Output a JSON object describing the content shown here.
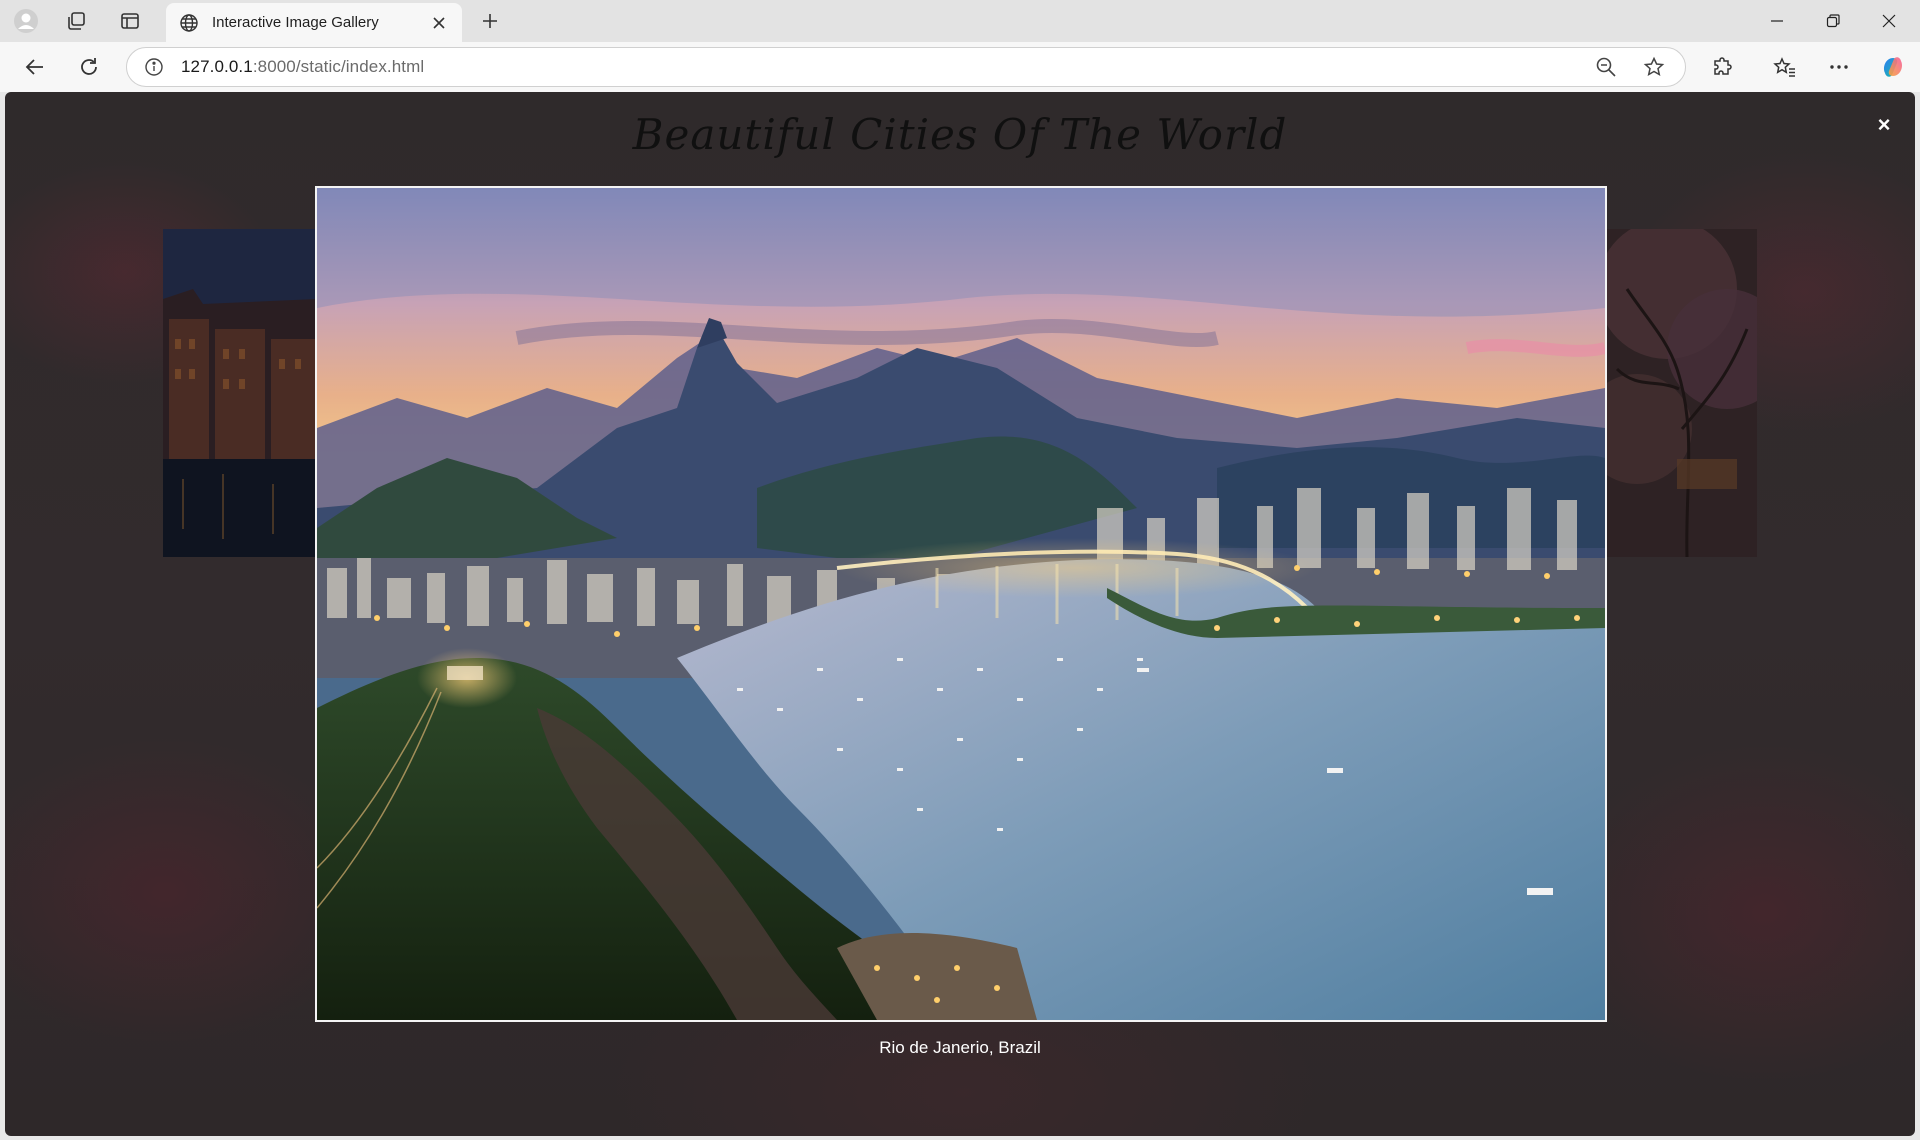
{
  "browser": {
    "tab_title": "Interactive Image Gallery",
    "url_host": "127.0.0.1",
    "url_rest": ":8000/static/index.html",
    "icons": [
      "profile-icon",
      "workspaces-icon",
      "tab-actions-icon",
      "globe-icon",
      "close-icon",
      "plus-icon",
      "minimize-icon",
      "restore-icon",
      "window-close-icon",
      "back-icon",
      "reload-icon",
      "info-icon",
      "zoom-out-icon",
      "star-icon",
      "extensions-icon",
      "favorites-icon",
      "more-icon",
      "copilot-icon"
    ]
  },
  "gallery": {
    "title": "Beautiful Cities Of The World",
    "close_label": "×",
    "caption": "Rio de Janerio, Brazil"
  },
  "colors": {
    "page_bg": "#2f2a2b",
    "caption_text": "#ffffff",
    "photo_border": "#f4f4f4"
  }
}
